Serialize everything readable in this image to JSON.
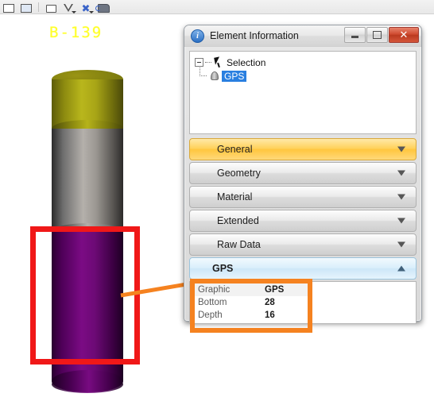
{
  "toolbar": {
    "icons": [
      {
        "name": "window-icon",
        "label": ""
      },
      {
        "name": "image-icon",
        "label": ""
      },
      {
        "name": "box-select-icon",
        "label": ""
      },
      {
        "name": "filter-funnel-icon",
        "label": ""
      },
      {
        "name": "tools-cross-icon",
        "label": ""
      },
      {
        "name": "camera-view-icon",
        "label": ""
      }
    ]
  },
  "viewport": {
    "borehole_label": "B-139",
    "segments": [
      {
        "name": "olive-segment",
        "color": "#8e8c10"
      },
      {
        "name": "gray-segment",
        "color": "#b4b0ab"
      },
      {
        "name": "purple-segment",
        "color": "#7b0b84"
      }
    ],
    "highlight_color": "#f01818",
    "leader_color": "#f58220"
  },
  "dialog": {
    "title": "Element Information",
    "info_icon": "i",
    "window_buttons": {
      "minimize": "minimize-button",
      "maximize": "maximize-button",
      "close": "✕"
    },
    "tree": {
      "root": "Selection",
      "child": "GPS"
    },
    "sections": [
      {
        "label": "General",
        "state": "collapsed",
        "style": "general"
      },
      {
        "label": "Geometry",
        "state": "collapsed",
        "style": "normal"
      },
      {
        "label": "Material",
        "state": "collapsed",
        "style": "normal"
      },
      {
        "label": "Extended",
        "state": "collapsed",
        "style": "normal"
      },
      {
        "label": "Raw Data",
        "state": "collapsed",
        "style": "normal"
      },
      {
        "label": "GPS",
        "state": "expanded",
        "style": "gps"
      }
    ],
    "gps_properties": [
      {
        "key": "Graphic",
        "value": "GPS"
      },
      {
        "key": "Bottom",
        "value": "28"
      },
      {
        "key": "Depth",
        "value": "16"
      }
    ]
  },
  "colors": {
    "accent_orange": "#f58220",
    "highlight_red": "#f01818",
    "general_amber": "#ffc63f",
    "gps_blue": "#cde7f8",
    "selection_blue": "#2a7fe0",
    "label_yellow": "#ffff2a"
  }
}
